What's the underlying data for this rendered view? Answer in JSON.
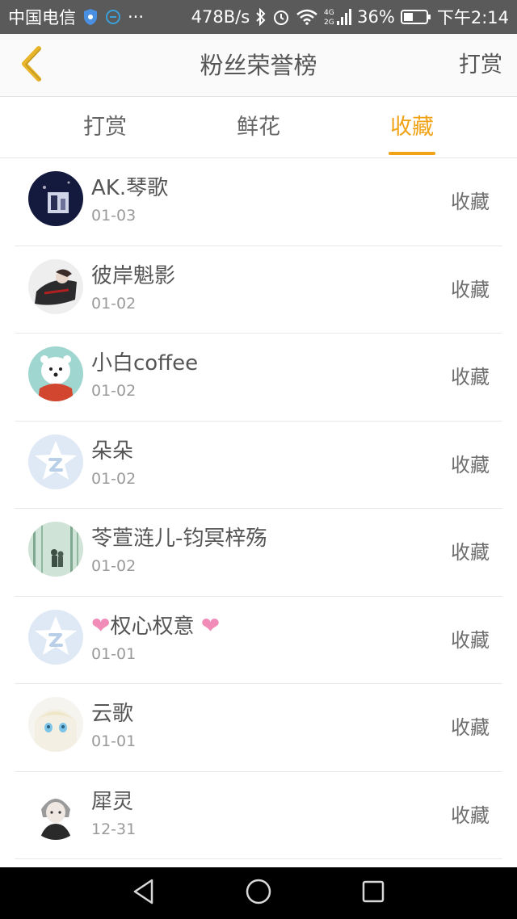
{
  "status_bar": {
    "carrier": "中国电信",
    "speed": "478B/s",
    "network": "4G 2G",
    "battery": "36%",
    "time": "下午2:14",
    "ellipsis": "···"
  },
  "nav": {
    "title": "粉丝荣誉榜",
    "action": "打赏"
  },
  "tabs": [
    {
      "label": "打赏"
    },
    {
      "label": "鲜花"
    },
    {
      "label": "收藏"
    }
  ],
  "active_tab": "收藏",
  "accent_color": "#f0a317",
  "fans": [
    {
      "name": "AK.琴歌",
      "date": "01-03",
      "type": "收藏"
    },
    {
      "name": "彼岸魁影",
      "date": "01-02",
      "type": "收藏"
    },
    {
      "name": "小白coffee",
      "date": "01-02",
      "type": "收藏"
    },
    {
      "name": "朵朵",
      "date": "01-02",
      "type": "收藏"
    },
    {
      "name": "苓萱涟儿-钧冥梓殇",
      "date": "01-02",
      "type": "收藏"
    },
    {
      "name": "权心权意",
      "name_prefix": "❤",
      "name_suffix": "❤",
      "date": "01-01",
      "type": "收藏"
    },
    {
      "name": "云歌",
      "date": "01-01",
      "type": "收藏"
    },
    {
      "name": "犀灵",
      "date": "12-31",
      "type": "收藏"
    }
  ]
}
